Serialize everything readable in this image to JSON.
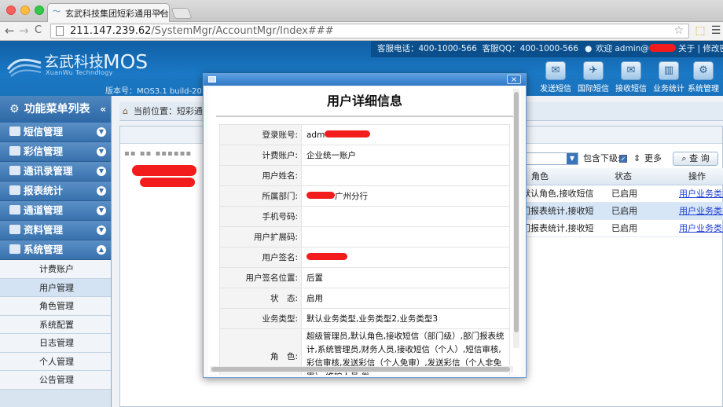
{
  "browser": {
    "tab_title": "玄武科技集团短彩通用平台",
    "tab_close": "×",
    "url_host": "211.147.239.62",
    "url_path": "/SystemMgr/AccountMgr/Index###",
    "back": "←",
    "forward": "→",
    "reload": "C",
    "star": "☆"
  },
  "header": {
    "logo_cn": "玄武科技",
    "logo_en": "XuanWu Technology",
    "logo_mos": "MOS",
    "version": "版本号：MOS3.1 build-2015",
    "topinfo": {
      "phone": "客服电话：400-1000-566",
      "qq": "客服QQ：400-1000-566",
      "welcome": "欢迎 admin@",
      "links": "关于 | 修改密码 | 退出"
    },
    "tools": [
      {
        "label": "发送短信",
        "icon": "send-sms-icon",
        "glyph": "✉"
      },
      {
        "label": "国际短信",
        "icon": "intl-sms-icon",
        "glyph": "✈"
      },
      {
        "label": "接收短信",
        "icon": "receive-sms-icon",
        "glyph": "✉"
      },
      {
        "label": "业务统计",
        "icon": "stats-icon",
        "glyph": "▥"
      },
      {
        "label": "系统管理",
        "icon": "system-icon",
        "glyph": "⚙"
      }
    ]
  },
  "sidebar": {
    "title": "功能菜单列表",
    "groups": [
      {
        "label": "短信管理"
      },
      {
        "label": "彩信管理"
      },
      {
        "label": "通讯录管理"
      },
      {
        "label": "报表统计"
      },
      {
        "label": "通道管理"
      },
      {
        "label": "资料管理"
      },
      {
        "label": "系统管理"
      }
    ],
    "subitems": [
      "计费账户",
      "用户管理",
      "角色管理",
      "系统配置",
      "日志管理",
      "个人管理",
      "公告管理"
    ]
  },
  "content": {
    "breadcrumb": "当前位置：短彩通",
    "include_sub_label": "包含下级:",
    "more_label": "更多",
    "query_label": "查 询",
    "columns": [
      "角色",
      "状态",
      "操作"
    ],
    "rows": [
      {
        "role": "默认角色,接收短信",
        "status": "已启用",
        "op": "用户业务类型"
      },
      {
        "role": "门报表统计,接收短",
        "status": "已启用",
        "op": "用户业务类型"
      },
      {
        "role": "门报表统计,接收短",
        "status": "已启用",
        "op": "用户业务类型"
      }
    ]
  },
  "modal": {
    "title": "用户详细信息",
    "close": "×",
    "fields": [
      {
        "label": "登录账号:",
        "value": "adm"
      },
      {
        "label": "计费账户:",
        "value": "企业统一账户"
      },
      {
        "label": "用户姓名:",
        "value": ""
      },
      {
        "label": "所属部门:",
        "value": "广州分行"
      },
      {
        "label": "手机号码:",
        "value": ""
      },
      {
        "label": "用户扩展码:",
        "value": ""
      },
      {
        "label": "用户签名:",
        "value": ""
      },
      {
        "label": "用户签名位置:",
        "value": "后置"
      },
      {
        "label": "状　态:",
        "value": "启用"
      },
      {
        "label": "业务类型:",
        "value": "默认业务类型,业务类型2,业务类型3"
      },
      {
        "label": "角　色:",
        "value": "超级管理员,默认角色,接收短信（部门级）,部门报表统计,系统管理员,财务人员,接收短信（个人）,短信审核,彩信审核,发送彩信（个人免审）,发送彩信（个人非免审）,维护人员,发"
      }
    ]
  },
  "colors": {
    "accent": "#1b78c4",
    "link": "#1f3fd6",
    "redaction": "#f21c1c"
  }
}
